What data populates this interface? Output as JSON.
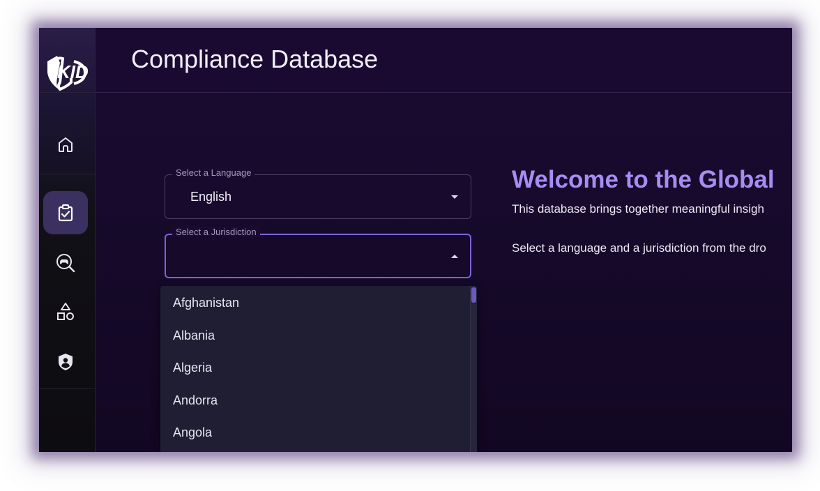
{
  "app": {
    "title": "Compliance Database",
    "logo_text": "KID"
  },
  "sidebar": {
    "items": [
      {
        "name": "home",
        "icon": "home-icon",
        "active": false
      },
      {
        "name": "compliance",
        "icon": "clipboard-check-icon",
        "active": true
      },
      {
        "name": "game-search",
        "icon": "gamepad-search-icon",
        "active": false
      },
      {
        "name": "categories",
        "icon": "shapes-icon",
        "active": false
      },
      {
        "name": "privacy",
        "icon": "shield-user-icon",
        "active": false
      }
    ]
  },
  "form": {
    "language": {
      "label": "Select a Language",
      "value": "English"
    },
    "jurisdiction": {
      "label": "Select a Jurisdiction",
      "value": "",
      "options": [
        "Afghanistan",
        "Albania",
        "Algeria",
        "Andorra",
        "Angola"
      ]
    }
  },
  "welcome": {
    "title": "Welcome to the Global",
    "line1": "This database brings together meaningful insigh",
    "line2": "Select a language and a jurisdiction from the dro"
  },
  "colors": {
    "accent": "#a48ef2",
    "focus": "#7b63d8",
    "background": "#1a0a32",
    "sidebar_active": "#3a3160"
  }
}
